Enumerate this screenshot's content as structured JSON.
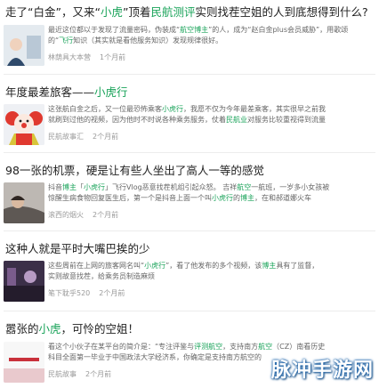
{
  "articles": [
    {
      "title": {
        "pre": "走了“白金”，又来“",
        "hl1": "小虎",
        "mid": "”顶着",
        "hl2": "民航测评",
        "post": "实则找茬空姐的人到底想得到什么?"
      },
      "body": [
        [
          "最近这位都以",
          "",
          "于发现了流量密码，伪装成“",
          "航空博主",
          "”的人，成为“赵白金plus会员威胁”，用歌颂"
        ],
        [
          "的“",
          "飞行",
          "知识（其实就是看他服务知识）发现规律很好。",
          "",
          ""
        ]
      ],
      "meta": {
        "source": "林荫具大本营",
        "time": "1个月前"
      }
    },
    {
      "title": {
        "pre": "年度最差旅客——",
        "hl1": "小虎行",
        "mid": "",
        "hl2": "",
        "post": ""
      },
      "body": [
        [
          "这张航白金之后，又一位最恐怖乘客",
          "小虎行",
          "，我愿不仅为今年最差乘客，其实很早之前我"
        ],
        [
          "就刷到过他的视频，因为他时不时说各种乘务服务，仗着",
          "民航业",
          "对服务比较重视得到流量"
        ]
      ],
      "meta": {
        "source": "民航故事汇",
        "time": "2个月前"
      }
    },
    {
      "title": {
        "pre": "98一张的机票，硬是让有些人坐出了高人一等的感觉",
        "hl1": "",
        "mid": "",
        "hl2": "",
        "post": ""
      },
      "body": [
        [
          "抖音",
          "博主",
          "「",
          "小虎行",
          "」飞行Vlog恶意找茬机组引起众怒。 吉祥",
          "航空",
          "一航班，一岁多小女孩被"
        ],
        [
          "惊醒生病食物回复医生后，第一个是抖音上面一个叫",
          "小虎行",
          "的",
          "博主",
          "，在和郝道娜火车"
        ]
      ],
      "meta": {
        "source": "滚西的烟火",
        "time": "2个月前"
      }
    },
    {
      "title": {
        "pre": "这种人就是平时大嘴巴挨的少",
        "hl1": "",
        "mid": "",
        "hl2": "",
        "post": ""
      },
      "body": [
        [
          "这些周前在上网的旅客网名叫“",
          "小虎行",
          "”，看了他发布的多个视频，该",
          "博主",
          "具有了监督，"
        ],
        [
          "实则故意找茬，给乘务员制造麻烦",
          "",
          "",
          "",
          ""
        ]
      ],
      "meta": {
        "source": "笔下耽乎520",
        "time": "2个月前"
      }
    },
    {
      "title": {
        "pre": "嚣张的",
        "hl1": "小虎",
        "mid": "，可怜的空姐！",
        "hl2": "",
        "post": ""
      },
      "body": [
        [
          "看这个小伙子在某平台的简介是：“专注评鉴与",
          "评测航空",
          "，支持南方",
          "航空",
          "（CZ）南看历史"
        ],
        [
          "科目全面第一毕业于中国政法大学经济系，你确定是支持南方航空的",
          "",
          "",
          "",
          ""
        ]
      ],
      "meta": {
        "source": "民航故事",
        "time": "2个月前"
      }
    }
  ],
  "watermark": "脉冲手游网",
  "colors": {
    "highlight": "#1aa35a",
    "title": "#222222",
    "body": "#666666",
    "meta": "#9a9a9a"
  }
}
